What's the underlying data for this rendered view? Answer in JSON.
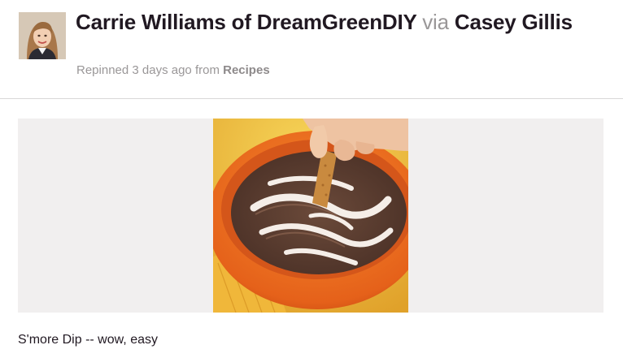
{
  "pin": {
    "pinner_name": "Carrie Williams of DreamGreenDIY",
    "via_word": "via",
    "source_user": "Casey Gillis",
    "repinned_prefix": "Repinned 3 days ago from",
    "board_name": "Recipes",
    "description": "S'more Dip -- wow, easy",
    "avatar_icon": "user-avatar",
    "image_icon": "smore-dip-photo"
  },
  "colors": {
    "text_dark": "#211922",
    "text_muted": "#9a9798",
    "divider": "#d9d7d7",
    "image_backdrop": "#f1efef",
    "bowl_orange": "#e8651a"
  }
}
